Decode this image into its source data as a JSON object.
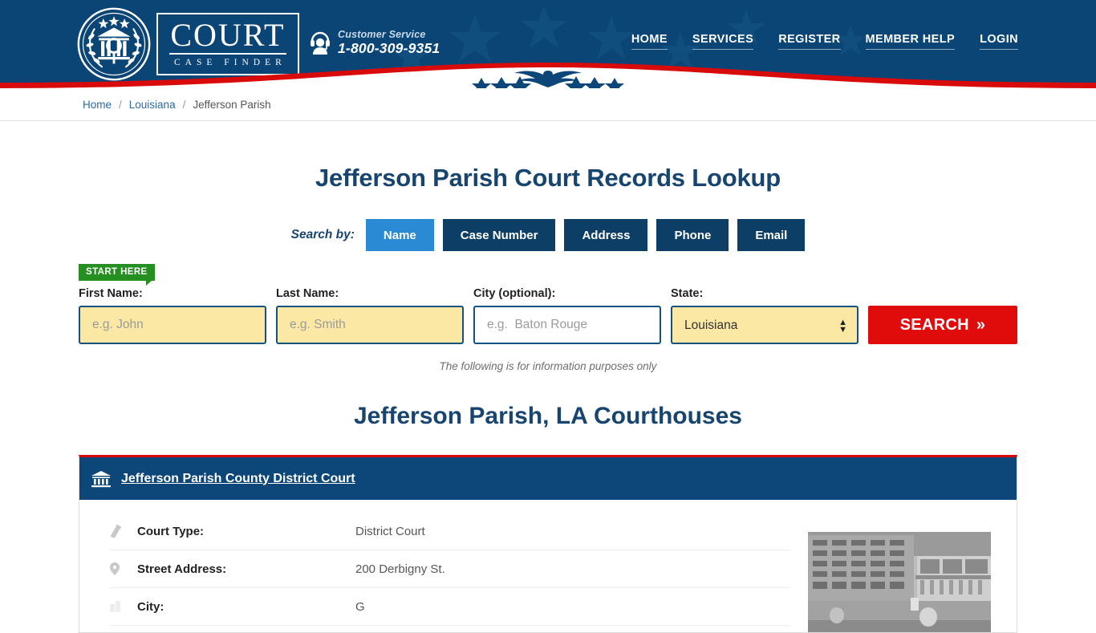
{
  "header": {
    "logo": {
      "main": "COURT",
      "sub": "CASE FINDER",
      "seal_icon": "court-seal-icon"
    },
    "customer_service": {
      "icon": "headset-support-icon",
      "label": "Customer Service",
      "phone": "1-800-309-9351"
    },
    "nav": [
      {
        "label": "HOME"
      },
      {
        "label": "SERVICES"
      },
      {
        "label": "REGISTER"
      },
      {
        "label": "MEMBER HELP"
      },
      {
        "label": "LOGIN"
      }
    ],
    "colors": {
      "blue": "#0a4576",
      "red": "#d80a0a",
      "white": "#ffffff"
    }
  },
  "breadcrumb": {
    "home": "Home",
    "sep": "/",
    "state": "Louisiana",
    "current": "Jefferson Parish"
  },
  "main": {
    "title": "Jefferson Parish Court Records Lookup",
    "search_by_label": "Search by:",
    "tabs": [
      {
        "label": "Name",
        "active": true
      },
      {
        "label": "Case Number",
        "active": false
      },
      {
        "label": "Address",
        "active": false
      },
      {
        "label": "Phone",
        "active": false
      },
      {
        "label": "Email",
        "active": false
      }
    ],
    "start_badge": "START HERE",
    "form": {
      "first_name": {
        "label": "First Name:",
        "placeholder": "e.g. John",
        "value": ""
      },
      "last_name": {
        "label": "Last Name:",
        "placeholder": "e.g. Smith",
        "value": ""
      },
      "city": {
        "label": "City (optional):",
        "placeholder": "e.g.  Baton Rouge",
        "value": ""
      },
      "state": {
        "label": "State:",
        "value": "Louisiana",
        "options": [
          "Louisiana"
        ]
      },
      "search_button": "SEARCH",
      "search_chevron": "»"
    },
    "disclaimer": "The following is for information purposes only",
    "subtitle": "Jefferson Parish, LA Courthouses",
    "court_card": {
      "icon": "courthouse-bank-icon",
      "name": "Jefferson Parish County District Court",
      "rows": [
        {
          "icon": "gavel-icon",
          "label": "Court Type:",
          "value": "District Court"
        },
        {
          "icon": "map-pin-icon",
          "label": "Street Address:",
          "value": "200 Derbigny St."
        },
        {
          "icon": "city-icon",
          "label": "City:",
          "value": "G"
        }
      ],
      "photo_alt": "courthouse-photo"
    }
  }
}
